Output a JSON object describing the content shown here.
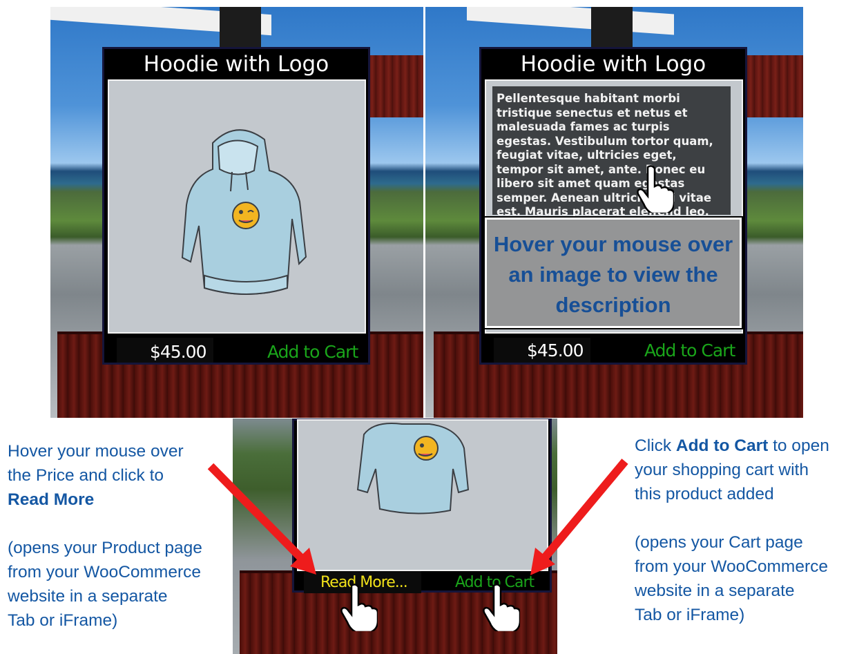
{
  "panels": [
    {
      "title": "Hoodie with Logo",
      "price": "$45.00",
      "cart_label": "Add to Cart"
    },
    {
      "title": "Hoodie with Logo",
      "description": "Pellentesque habitant morbi tristique senectus et netus et malesuada fames ac turpis egestas. Vestibulum tortor quam, feugiat vitae, ultricies eget, tempor sit amet, ante. Donec eu libero sit amet quam egestas semper. Aenean ultricies mi vitae est. Mauris placerat eleifend leo.",
      "callout": "Hover your mouse over an image to view the description",
      "price": "$45.00",
      "cart_label": "Add to Cart"
    },
    {
      "read_more_label": "Read More...",
      "cart_label": "Add to Cart"
    }
  ],
  "notes": {
    "left_line1": "Hover your mouse over",
    "left_line2": "the Price and click to",
    "left_bold": "Read More",
    "left_sub1": "(opens your Product page",
    "left_sub2": "from your WooCommerce",
    "left_sub3": "website in a separate",
    "left_sub4": "Tab or iFrame)",
    "right_pre": "Click ",
    "right_bold": "Add to Cart",
    "right_post": " to open",
    "right_line2": "your shopping cart with",
    "right_line3": "this product added",
    "right_sub1": "(opens your Cart page",
    "right_sub2": "from your WooCommerce",
    "right_sub3": "website in a separate",
    "right_sub4": "Tab or iFrame)"
  },
  "colors": {
    "note_text": "#1457a3",
    "callout_text": "#174f96",
    "add_to_cart": "#1aa51a",
    "read_more": "#f2e21a",
    "arrow": "#ee1c1c"
  },
  "icons": [
    "hoodie-image",
    "pointing-hand-icon",
    "red-arrow-icon"
  ]
}
